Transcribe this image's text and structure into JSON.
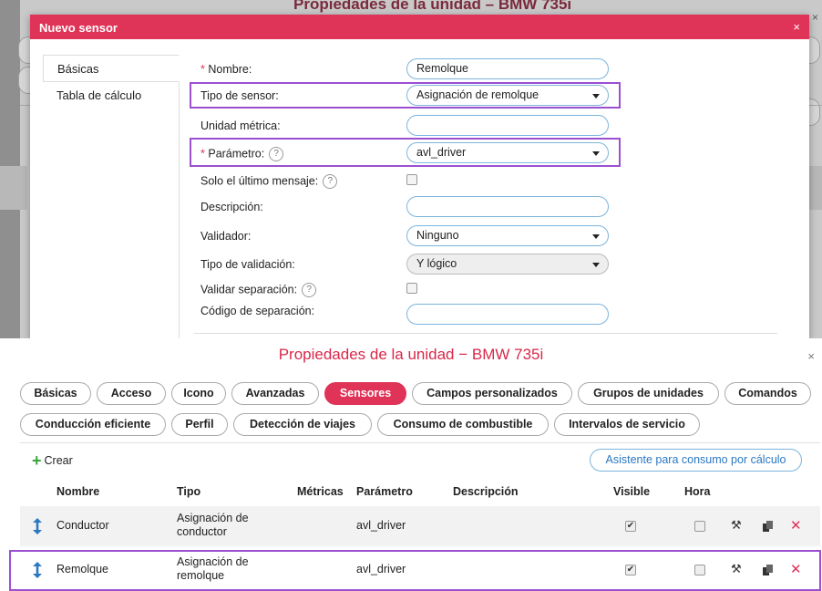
{
  "background_window": {
    "title": "Propiedades de la unidad – BMW 735i",
    "close_icon": "×"
  },
  "modal": {
    "title": "Nuevo sensor",
    "close_icon": "×",
    "side_tabs": [
      "Básicas",
      "Tabla de cálculo"
    ],
    "fields": {
      "nombre": {
        "label": "Nombre:",
        "value": "Remolque",
        "required": "*"
      },
      "tipo_sensor": {
        "label": "Tipo de sensor:",
        "value": "Asignación de remolque"
      },
      "unidad_metrica": {
        "label": "Unidad métrica:",
        "value": ""
      },
      "parametro": {
        "label": "Parámetro:",
        "value": "avl_driver",
        "required": "*"
      },
      "solo_ultimo": {
        "label": "Solo el último mensaje:"
      },
      "descripcion": {
        "label": "Descripción:",
        "value": ""
      },
      "validador": {
        "label": "Validador:",
        "value": "Ninguno"
      },
      "tipo_validacion": {
        "label": "Tipo de validación:",
        "value": "Y lógico"
      },
      "validar_separacion": {
        "label": "Validar separación:"
      },
      "codigo_separacion": {
        "label": "Código de separación:",
        "value": ""
      }
    },
    "help_icon": "?"
  },
  "dialog": {
    "title": "Propiedades de la unidad − BMW 735i",
    "close_icon": "×",
    "tabs_row1": [
      "Básicas",
      "Acceso",
      "Icono",
      "Avanzadas",
      "Sensores",
      "Campos personalizados",
      "Grupos de unidades",
      "Comandos"
    ],
    "tabs_row2": [
      "Conducción eficiente",
      "Perfil",
      "Detección de viajes",
      "Consumo de combustible",
      "Intervalos de servicio"
    ],
    "active_tab": "Sensores",
    "create_label": "Crear",
    "create_icon": "+",
    "wizard_label": "Asistente para consumo por cálculo",
    "columns": [
      "Nombre",
      "Tipo",
      "Métricas",
      "Parámetro",
      "Descripción",
      "Visible",
      "Hora"
    ],
    "rows": [
      {
        "nombre": "Conductor",
        "tipo_l1": "Asignación de",
        "tipo_l2": "conductor",
        "metricas": "",
        "parametro": "avl_driver",
        "descripcion": "",
        "visible": true,
        "hora": false
      },
      {
        "nombre": "Remolque",
        "tipo_l1": "Asignación de",
        "tipo_l2": "remolque",
        "metricas": "",
        "parametro": "avl_driver",
        "descripcion": "",
        "visible": true,
        "hora": false
      }
    ],
    "check_mark": "✔",
    "delete_icon": "✕"
  },
  "colors": {
    "accent": "#e03358",
    "highlight": "#9b4fd1",
    "link": "#2b78c2",
    "create": "#3aa33a"
  }
}
